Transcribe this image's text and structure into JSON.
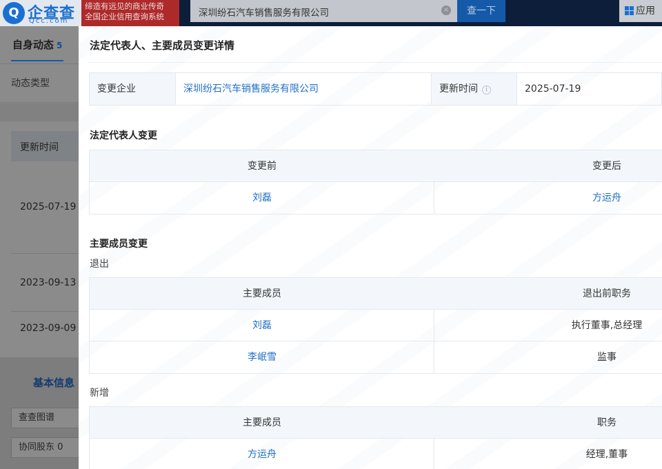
{
  "header": {
    "logo_glyph": "Q",
    "logo_name": "企查查",
    "logo_domain": "Qcc.com",
    "slogan_line1": "缔造有远见的商业传奇",
    "slogan_line2": "全国企业信用查询系统",
    "search_value": "深圳纷石汽车销售服务有限公司",
    "search_clear_glyph": "×",
    "search_button": "查一下",
    "app_label": "应用"
  },
  "background": {
    "tab_label": "自身动态",
    "tab_count": "5",
    "filter_label": "动态类型",
    "column_header": "更新时间",
    "rows": [
      "2025-07-19",
      "2023-09-13",
      "2023-09-09"
    ],
    "basic_info": "基本信息",
    "chips": [
      "查查图谱",
      "协同股东 0"
    ]
  },
  "modal": {
    "title": "法定代表人、主要成员变更详情",
    "info": {
      "company_label": "变更企业",
      "company_value": "深圳纷石汽车销售服务有限公司",
      "time_label": "更新时间",
      "time_value": "2025-07-19"
    },
    "legal_rep": {
      "title": "法定代表人变更",
      "headers": [
        "变更前",
        "变更后"
      ],
      "before": "刘磊",
      "after": "方运舟"
    },
    "members": {
      "title": "主要成员变更",
      "exit": {
        "label": "退出",
        "headers": [
          "主要成员",
          "退出前职务"
        ],
        "rows": [
          {
            "name": "刘磊",
            "role": "执行董事,总经理"
          },
          {
            "name": "李岷雪",
            "role": "监事"
          }
        ]
      },
      "added": {
        "label": "新增",
        "headers": [
          "主要成员",
          "职务"
        ],
        "rows": [
          {
            "name": "方运舟",
            "role": "经理,董事"
          }
        ]
      }
    }
  }
}
